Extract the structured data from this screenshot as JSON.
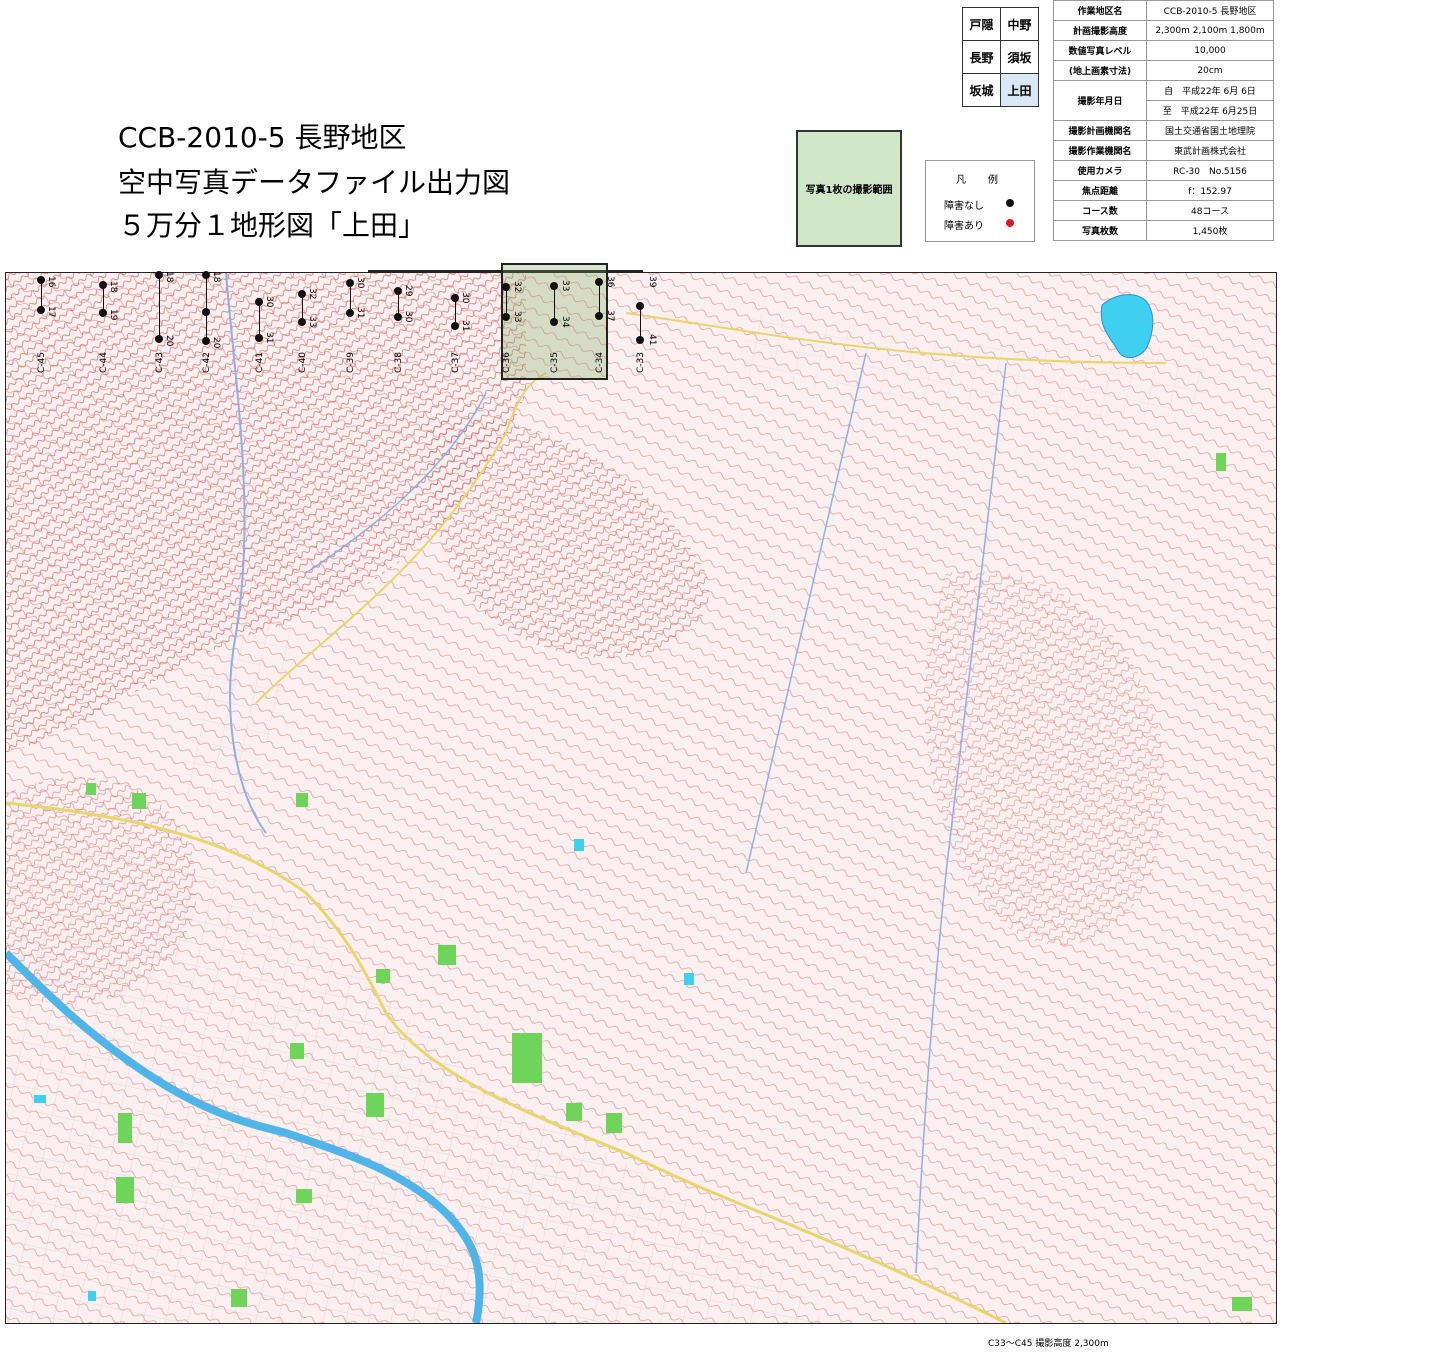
{
  "title": {
    "line1": "CCB-2010-5 長野地区",
    "line2": "空中写真データファイル出力図",
    "line3": "５万分１地形図「上田」"
  },
  "index_map": {
    "rows": [
      [
        "戸隠",
        "中野"
      ],
      [
        "長野",
        "須坂"
      ],
      [
        "坂城",
        "上田"
      ]
    ],
    "current": "上田"
  },
  "coverage_label": "写真1枚の撮影範囲",
  "legend": {
    "title": "凡　例",
    "items": [
      {
        "label": "障害なし",
        "color": "#111111"
      },
      {
        "label": "障害あり",
        "color": "#e0191e"
      }
    ]
  },
  "info_table": [
    {
      "key": "作業地区名",
      "value": "CCB-2010-5 長野地区"
    },
    {
      "key": "計画撮影高度",
      "value": "2,300m 2,100m 1,800m"
    },
    {
      "key": "数値写真レベル",
      "value": "10,000"
    },
    {
      "key": "(地上画素寸法)",
      "value": "20cm"
    },
    {
      "key": "撮影年月日",
      "value": "自　平成22年 6月 6日"
    },
    {
      "key": "",
      "value": "至　平成22年 6月25日"
    },
    {
      "key": "撮影計画機関名",
      "value": "国土交通省国土地理院"
    },
    {
      "key": "撮影作業機関名",
      "value": "東武計画株式会社"
    },
    {
      "key": "使用カメラ",
      "value": "RC-30　No.5156"
    },
    {
      "key": "焦点距離",
      "value": "f：152.97"
    },
    {
      "key": "コース数",
      "value": "48コース"
    },
    {
      "key": "写真枚数",
      "value": "1,450枚"
    }
  ],
  "courses": [
    {
      "name": "C-45",
      "photos": [
        "16",
        "17"
      ]
    },
    {
      "name": "C-44",
      "photos": [
        "18",
        "19"
      ]
    },
    {
      "name": "C-43",
      "photos": [
        "18",
        "20"
      ]
    },
    {
      "name": "C-42",
      "photos": [
        "18",
        "20"
      ]
    },
    {
      "name": "C-41",
      "photos": [
        "30",
        "31"
      ]
    },
    {
      "name": "C-40",
      "photos": [
        "32",
        "33"
      ]
    },
    {
      "name": "C-39",
      "photos": [
        "30",
        "31"
      ]
    },
    {
      "name": "C-38",
      "photos": [
        "29",
        "30"
      ]
    },
    {
      "name": "C-37",
      "photos": [
        "30",
        "31"
      ]
    },
    {
      "name": "C-36",
      "photos": [
        "32",
        "33"
      ]
    },
    {
      "name": "C-35",
      "photos": [
        "33",
        "34"
      ]
    },
    {
      "name": "C-34",
      "photos": [
        "36",
        "37"
      ]
    },
    {
      "name": "C-33",
      "photos": [
        "39",
        "41"
      ]
    }
  ],
  "footer": "C33～C45 撮影高度 2,300m",
  "colors": {
    "contour": "#d98a8a",
    "terrain": "#f6dcdc",
    "water": "#4fb4e8",
    "vegetation": "#6fd45a",
    "road": "#e8d66a"
  }
}
